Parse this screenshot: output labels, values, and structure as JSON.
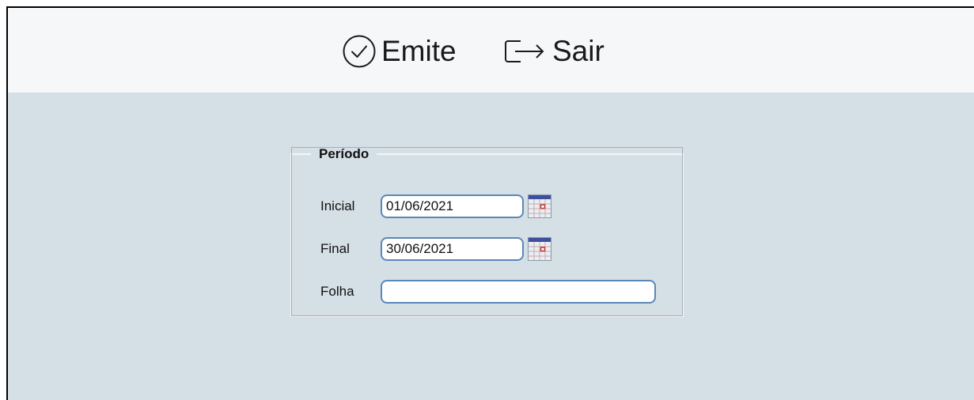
{
  "toolbar": {
    "emite_label": "Emite",
    "sair_label": "Sair"
  },
  "periodo": {
    "legend": "Período",
    "inicial_label": "Inicial",
    "inicial_value": "01/06/2021",
    "final_label": "Final",
    "final_value": "30/06/2021",
    "folha_label": "Folha",
    "folha_value": ""
  },
  "colors": {
    "toolbar_bg": "#f6f7f9",
    "content_bg": "#d5dfe6",
    "input_border": "#5b87b8"
  },
  "icons": {
    "emite": "check-circle-icon",
    "sair": "exit-icon",
    "calendar": "calendar-icon"
  }
}
